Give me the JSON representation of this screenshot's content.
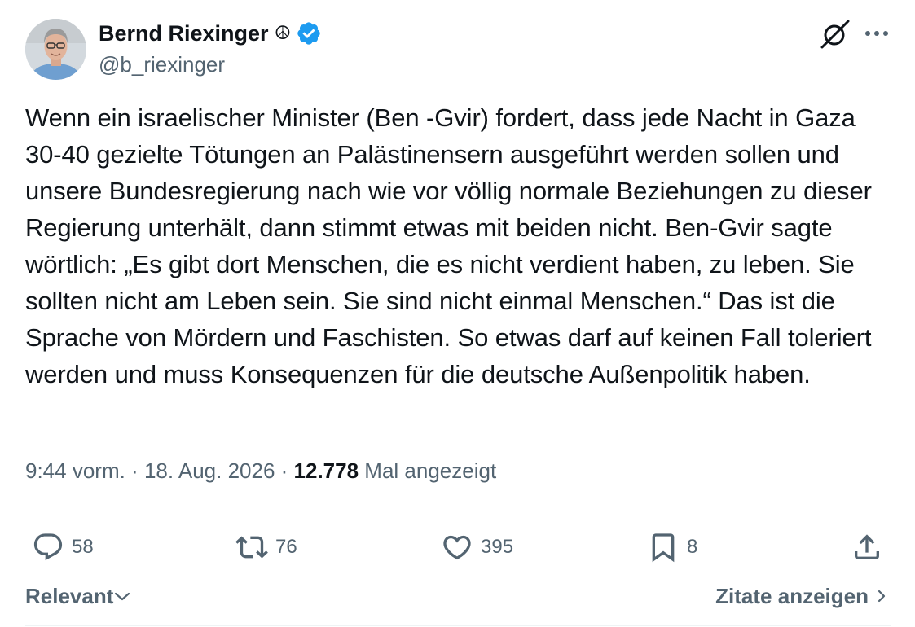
{
  "author": {
    "display_name": "Bernd Riexinger",
    "emoji": "☮",
    "handle": "@b_riexinger",
    "verified": true
  },
  "tweet": {
    "text": "Wenn ein israelischer Minister (Ben -Gvir) fordert, dass jede Nacht in Gaza 30-40 gezielte Tötungen an Palästinensern ausgeführt werden sollen und unsere Bundesregierung nach wie vor völlig normale Beziehungen zu dieser Regierung unterhält, dann stimmt etwas mit beiden nicht. Ben-Gvir sagte wörtlich: „Es gibt dort Menschen, die es nicht verdient haben, zu leben. Sie sollten nicht am Leben sein. Sie sind nicht einmal Menschen.“ Das ist die Sprache von Mördern und Faschisten. So etwas darf auf keinen Fall toleriert werden und muss Konsequenzen für die deutsche Außenpolitik haben.",
    "time": "9:44 vorm.",
    "separator": " · ",
    "date": "18. Aug. 2026",
    "views_count": "12.778",
    "views_label": "Mal angezeigt"
  },
  "actions": {
    "replies": "58",
    "retweets": "76",
    "likes": "395",
    "bookmarks": "8"
  },
  "footer": {
    "sort_label": "Relevant",
    "quotes_label": "Zitate anzeigen"
  },
  "colors": {
    "text": "#0f1419",
    "secondary": "#536471",
    "verified": "#1d9bf0",
    "divider": "#eff3f4"
  },
  "icons": [
    "grok-icon",
    "more-icon",
    "verified-badge-icon",
    "reply-icon",
    "retweet-icon",
    "like-icon",
    "bookmark-icon",
    "share-icon",
    "chevron-down-icon",
    "chevron-right-icon"
  ]
}
